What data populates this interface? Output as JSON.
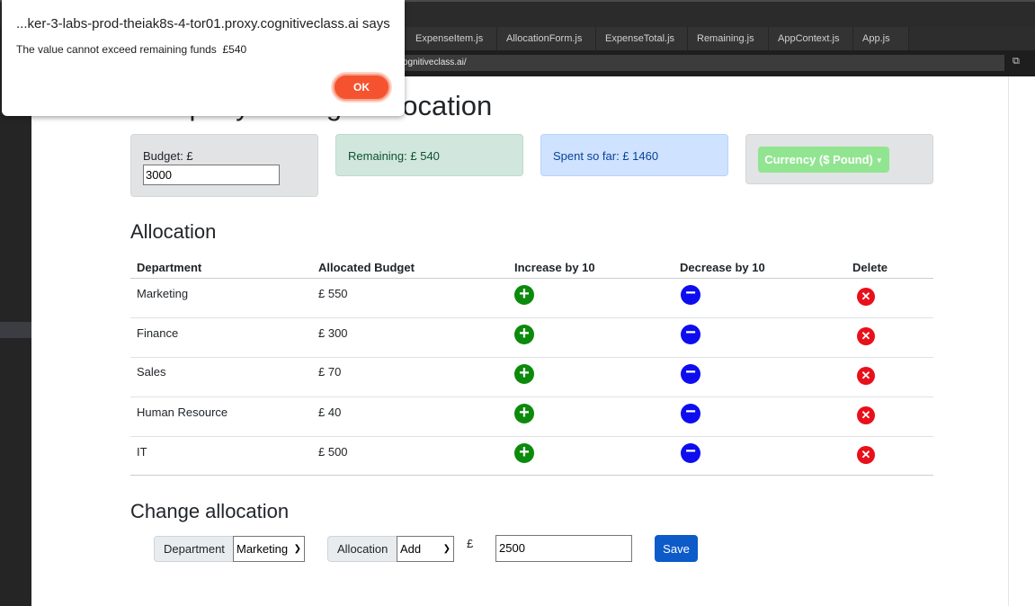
{
  "ide": {
    "tabs": [
      "ExpenseItem.js",
      "AllocationForm.js",
      "ExpenseTotal.js",
      "Remaining.js",
      "AppContext.js",
      "App.js"
    ],
    "url": "ognitiveclass.ai/"
  },
  "dialog": {
    "title": "...ker-3-labs-prod-theiak8s-4-tor01.proxy.cognitiveclass.ai says",
    "message": "The value cannot exceed remaining funds  £540",
    "ok_label": "OK"
  },
  "app": {
    "title": "Company's Budget Allocation",
    "budget_label": "Budget: £",
    "budget_value": "3000",
    "remaining_text": "Remaining: £ 540",
    "spent_text": "Spent so far: £ 1460",
    "currency_label": "Currency ($ Pound)",
    "allocation_title": "Allocation",
    "table_headers": [
      "Department",
      "Allocated Budget",
      "Increase by 10",
      "Decrease by 10",
      "Delete"
    ],
    "rows": [
      {
        "department": "Marketing",
        "budget": "£ 550"
      },
      {
        "department": "Finance",
        "budget": "£ 300"
      },
      {
        "department": "Sales",
        "budget": "£ 70"
      },
      {
        "department": "Human Resource",
        "budget": "£ 40"
      },
      {
        "department": "IT",
        "budget": "£ 500"
      }
    ],
    "change_title": "Change allocation",
    "form": {
      "department_label": "Department",
      "department_value": "Marketing",
      "allocation_label": "Allocation",
      "allocation_value": "Add",
      "currency_symbol": "£",
      "amount_value": "2500",
      "save_label": "Save"
    }
  },
  "colors": {
    "increase": "#0b8a0b",
    "decrease": "#0d0df0",
    "delete": "#e8101b",
    "save": "#0d5ac9",
    "ok": "#f5532f"
  }
}
